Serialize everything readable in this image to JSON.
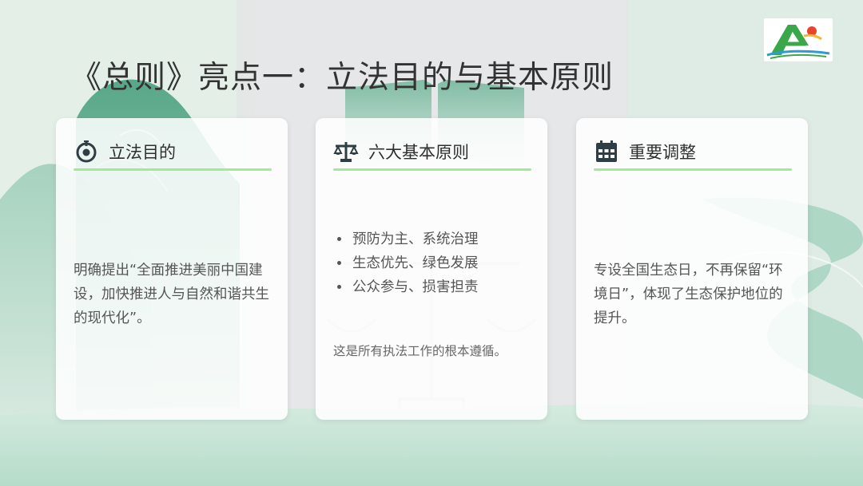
{
  "slide": {
    "title": "《总则》亮点一：立法目的与基本原则",
    "logo_icon": "green-a-logo-icon"
  },
  "cards": [
    {
      "icon": "target-icon",
      "title": "立法目的",
      "body": "明确提出“全面推进美丽中国建设，加快推进人与自然和谐共生的现代化”。"
    },
    {
      "icon": "scale-icon",
      "title": "六大基本原则",
      "bullets": [
        "预防为主、系统治理",
        "生态优先、绿色发展",
        "公众参与、损害担责"
      ],
      "note": "这是所有执法工作的根本遵循。"
    },
    {
      "icon": "calendar-icon",
      "title": "重要调整",
      "body": "专设全国生态日，不再保留“环境日”，体现了生态保护地位的提升。"
    }
  ],
  "colors": {
    "accent_line": "#a4e89c",
    "icon_dark": "#2f3d45",
    "mountain_green": "#5aa98a"
  }
}
